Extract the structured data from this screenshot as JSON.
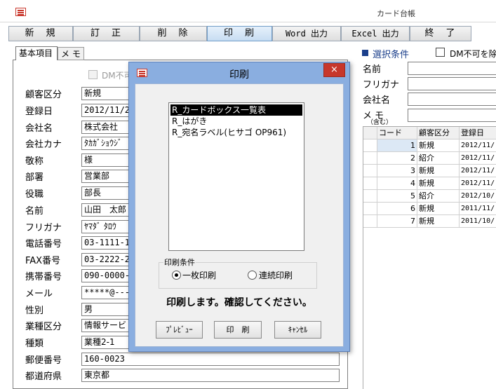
{
  "app": {
    "title": "カード台帳"
  },
  "toolbar": {
    "buttons": [
      "新　規",
      "訂　正",
      "削　除",
      "印　刷",
      "Word 出力",
      "Excel 出力",
      "終　了"
    ]
  },
  "tabs": {
    "basic": "基本項目",
    "memo": "メ モ"
  },
  "form": {
    "dm_label": "DM不可",
    "fields": [
      {
        "label": "顧客区分",
        "value": "新規"
      },
      {
        "label": "登録日",
        "value": "2012/11/2"
      },
      {
        "label": "会社名",
        "value": "株式会社"
      },
      {
        "label": "会社カナ",
        "value": "ﾀｶｶﾞｼｮｳｼﾞ"
      },
      {
        "label": "敬称",
        "value": "様"
      },
      {
        "label": "部署",
        "value": "営業部"
      },
      {
        "label": "役職",
        "value": "部長"
      },
      {
        "label": "名前",
        "value": "山田　太郎"
      },
      {
        "label": "フリガナ",
        "value": "ﾔﾏﾀﾞ ﾀﾛｳ"
      },
      {
        "label": "電話番号",
        "value": "03-1111-1"
      },
      {
        "label": "FAX番号",
        "value": "03-2222-2"
      },
      {
        "label": "携帯番号",
        "value": "090-0000-"
      },
      {
        "label": "メール",
        "value": "*****@---"
      },
      {
        "label": "性別",
        "value": "男"
      },
      {
        "label": "業種区分",
        "value": "情報サービ"
      },
      {
        "label": "種類",
        "value": "業種2-1"
      },
      {
        "label": "郵便番号",
        "value": "160-0023"
      },
      {
        "label": "都道府県",
        "value": "東京都"
      }
    ]
  },
  "selection": {
    "title": "選択条件",
    "dm_exclude_label": "DM不可を除",
    "labels": {
      "name": "名前",
      "furigana": "フリガナ",
      "company": "会社名",
      "memo": "メ モ",
      "memo_note": "（含む）"
    }
  },
  "grid": {
    "headers": [
      "コード",
      "顧客区分",
      "登録日"
    ],
    "rows": [
      {
        "code": "1",
        "type": "新規",
        "date": "2012/11/"
      },
      {
        "code": "2",
        "type": "紹介",
        "date": "2012/11/"
      },
      {
        "code": "3",
        "type": "新規",
        "date": "2012/11/"
      },
      {
        "code": "4",
        "type": "新規",
        "date": "2012/11/"
      },
      {
        "code": "5",
        "type": "紹介",
        "date": "2012/10/"
      },
      {
        "code": "6",
        "type": "新規",
        "date": "2011/11/"
      },
      {
        "code": "7",
        "type": "新規",
        "date": "2011/10/"
      }
    ]
  },
  "dialog": {
    "title": "印刷",
    "close": "×",
    "reports": [
      "R_カードボックス一覧表",
      "R_はがき",
      "R_宛名ラベル(ヒサゴ OP961)"
    ],
    "print_condition": "印刷条件",
    "option_single": "一枚印刷",
    "option_continuous": "連続印刷",
    "confirm": "印刷します。確認してください。",
    "buttons": {
      "preview": "ﾌﾟﾚﾋﾞｭｰ",
      "print": "印　刷",
      "cancel": "ｷｬﾝｾﾙ"
    }
  }
}
